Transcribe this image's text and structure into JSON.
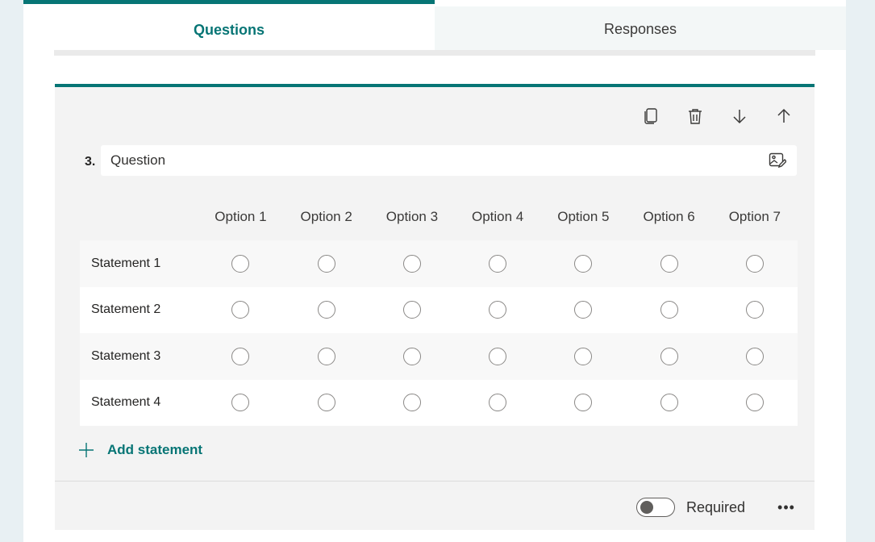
{
  "tabs": [
    {
      "label": "Questions",
      "active": true
    },
    {
      "label": "Responses",
      "active": false
    }
  ],
  "question": {
    "number": "3.",
    "placeholder": "Question"
  },
  "toolbar": {
    "icons": [
      "copy-icon",
      "delete-icon",
      "move-down-icon",
      "move-up-icon"
    ]
  },
  "grid": {
    "options": [
      "Option 1",
      "Option 2",
      "Option 3",
      "Option 4",
      "Option 5",
      "Option 6",
      "Option 7"
    ],
    "statements": [
      "Statement 1",
      "Statement 2",
      "Statement 3",
      "Statement 4"
    ]
  },
  "add_statement": {
    "label": "Add statement"
  },
  "footer": {
    "required_label": "Required",
    "required_on": false,
    "more_label": "•••"
  },
  "colors": {
    "accent": "#077575",
    "background": "#e8f0f3"
  }
}
